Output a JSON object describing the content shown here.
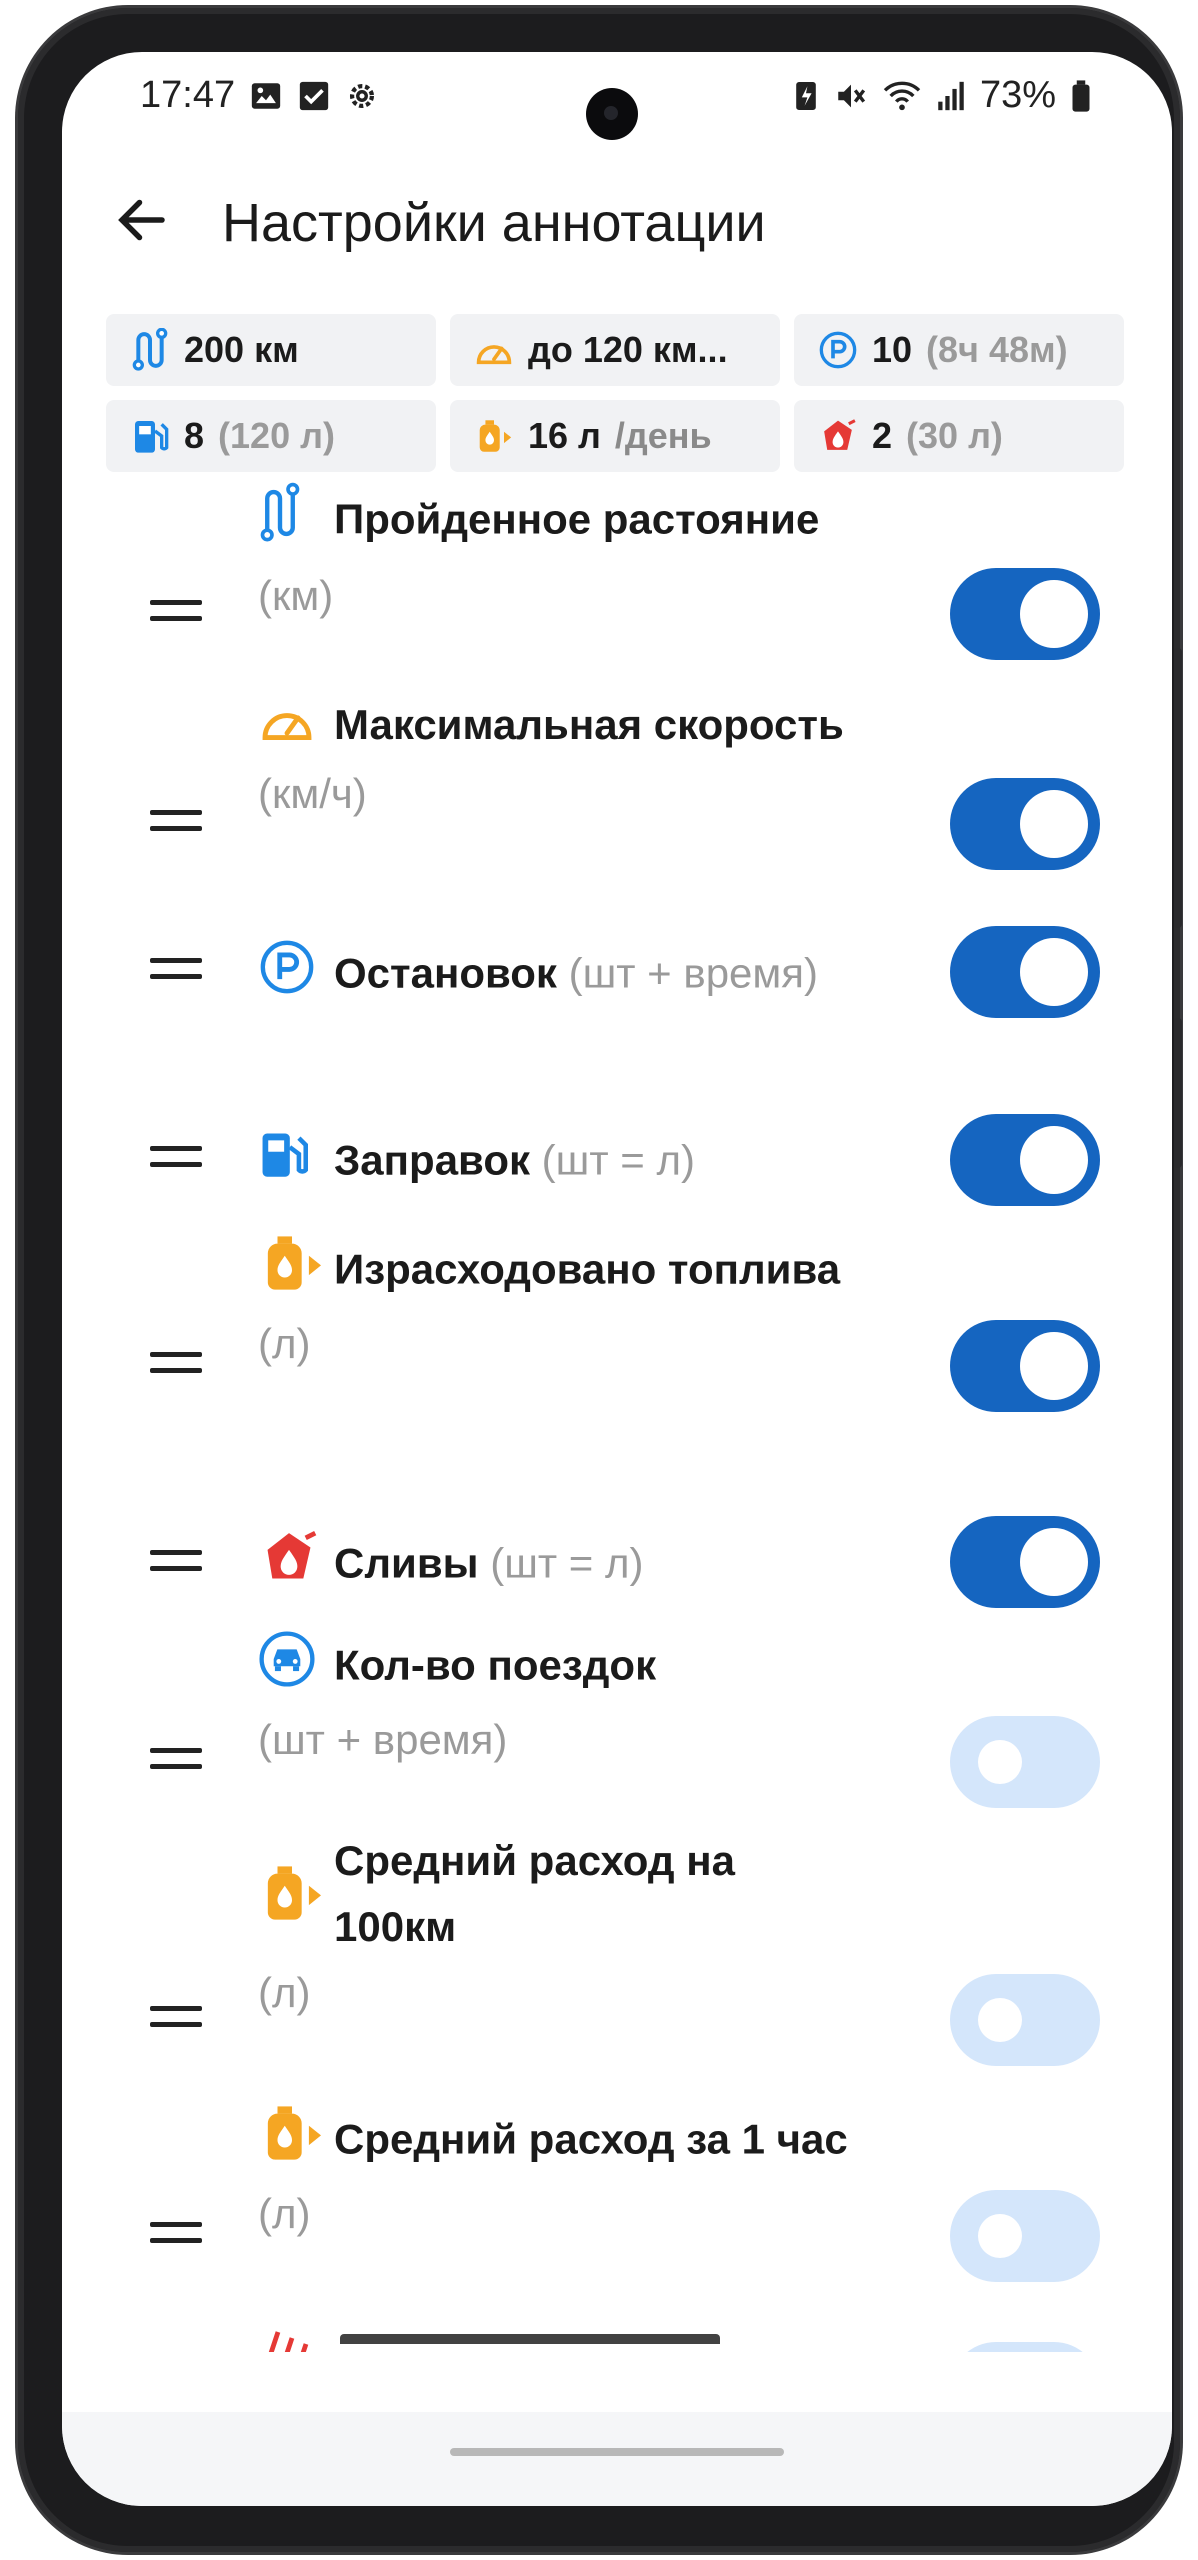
{
  "status": {
    "time": "17:47",
    "battery": "73%"
  },
  "header": {
    "title": "Настройки аннотации"
  },
  "chips": [
    {
      "icon": "route-icon",
      "value": "200 км",
      "extra": ""
    },
    {
      "icon": "speedometer-icon",
      "value": "до 120 км...",
      "extra": ""
    },
    {
      "icon": "parking-icon",
      "value": "10",
      "extra": "(8ч 48м)"
    },
    {
      "icon": "fuel-pump-icon",
      "value": "8",
      "extra": "(120 л)"
    },
    {
      "icon": "fuel-can-icon",
      "value": "16 л",
      "extra": "/день"
    },
    {
      "icon": "fuel-drain-icon",
      "value": "2",
      "extra": "(30 л)"
    }
  ],
  "items": [
    {
      "icon": "route-icon",
      "label": "Пройденное растояние",
      "unit": "(км)",
      "enabled": true
    },
    {
      "icon": "speedometer-icon",
      "label": "Максимальная скорость",
      "unit": "(км/ч)",
      "enabled": true
    },
    {
      "icon": "parking-icon",
      "label": "Остановок",
      "unit": "(шт + время)",
      "enabled": true
    },
    {
      "icon": "fuel-pump-icon",
      "label": "Заправок",
      "unit": "(шт = л)",
      "enabled": true
    },
    {
      "icon": "fuel-can-icon",
      "label": "Израсходовано топлива",
      "unit": "(л)",
      "enabled": true
    },
    {
      "icon": "fuel-drain-icon",
      "label": "Сливы",
      "unit": "(шт = л)",
      "enabled": true
    },
    {
      "icon": "car-icon",
      "label": "Кол-во поездок",
      "unit": "(шт + время)",
      "enabled": false
    },
    {
      "icon": "fuel-can-icon",
      "label": "Средний расход на 100км",
      "unit": "(л)",
      "enabled": false
    },
    {
      "icon": "fuel-can-icon",
      "label": "Средний расход за 1 час",
      "unit": "(л)",
      "enabled": false
    }
  ],
  "colors": {
    "toggle_on": "#1565c0",
    "toggle_off": "#d4e6fb",
    "accent_blue": "#1e88e5",
    "accent_orange": "#f5a623",
    "accent_red": "#e53935"
  }
}
